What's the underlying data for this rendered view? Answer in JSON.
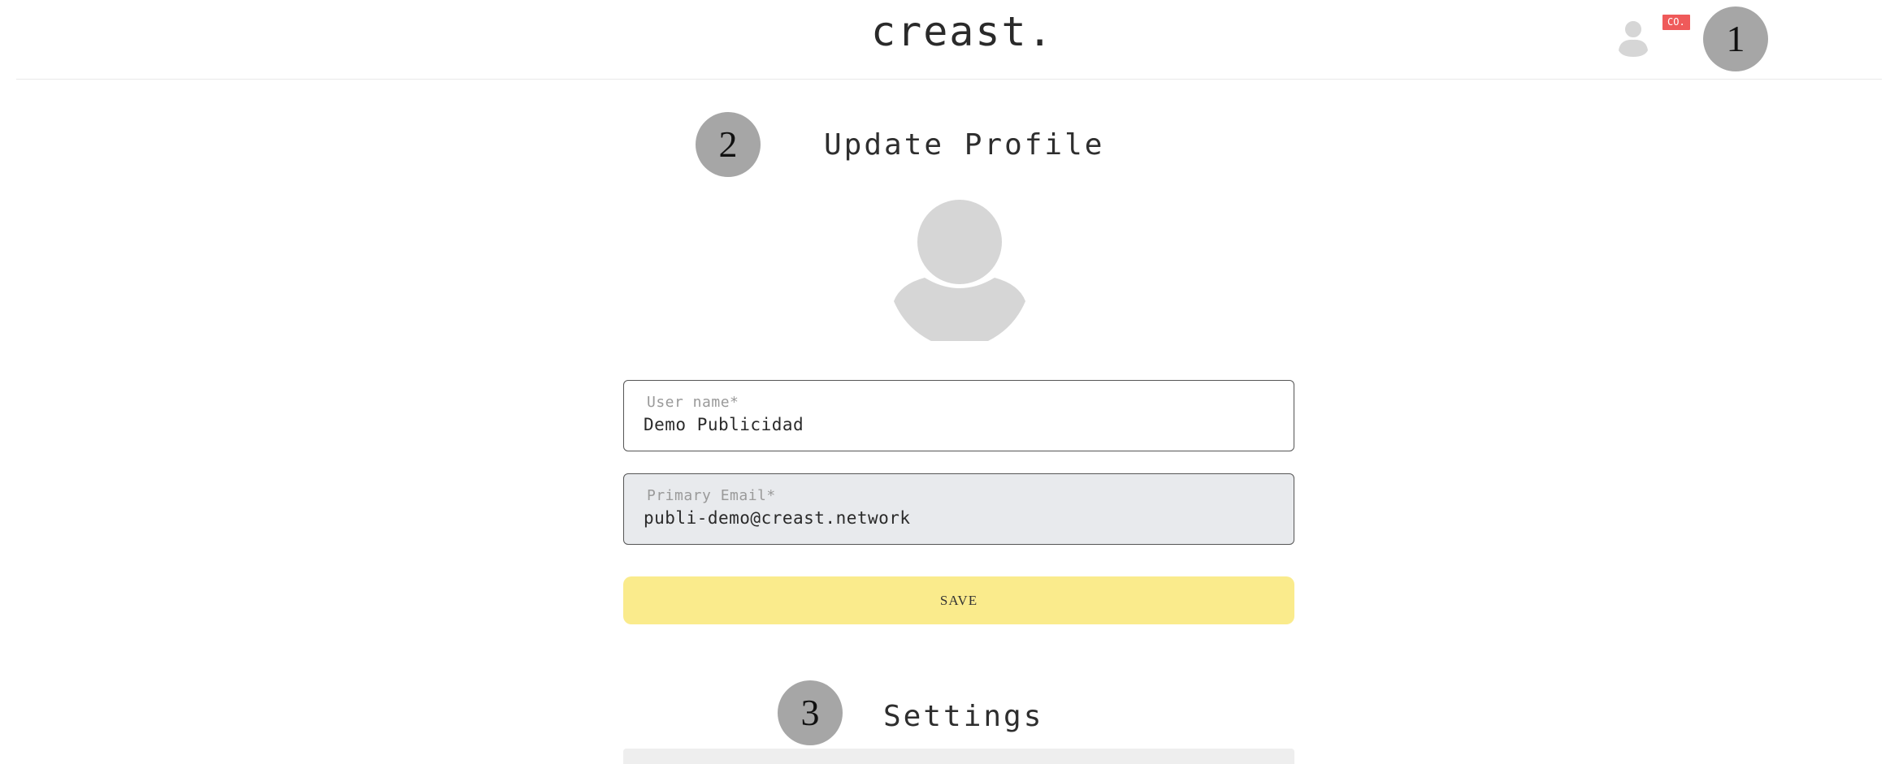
{
  "header": {
    "logo_text": "creast.",
    "account": {
      "icon": "user-icon",
      "company_badge": "CO."
    }
  },
  "markers": [
    "1",
    "2",
    "3"
  ],
  "profile": {
    "title": "Update Profile",
    "avatar_icon": "user-silhouette-icon",
    "username": {
      "label": "User name*",
      "value": "Demo Publicidad"
    },
    "email": {
      "label": "Primary Email*",
      "value": "publi-demo@creast.network"
    },
    "save_label": "SAVE"
  },
  "settings": {
    "title": "Settings"
  },
  "colors": {
    "save_button": "#faeb8c",
    "badge": "#ef5a5a",
    "marker": "#a6a6a6",
    "email_field_bg": "#e8eaed",
    "avatar": "#d6d6d6"
  }
}
